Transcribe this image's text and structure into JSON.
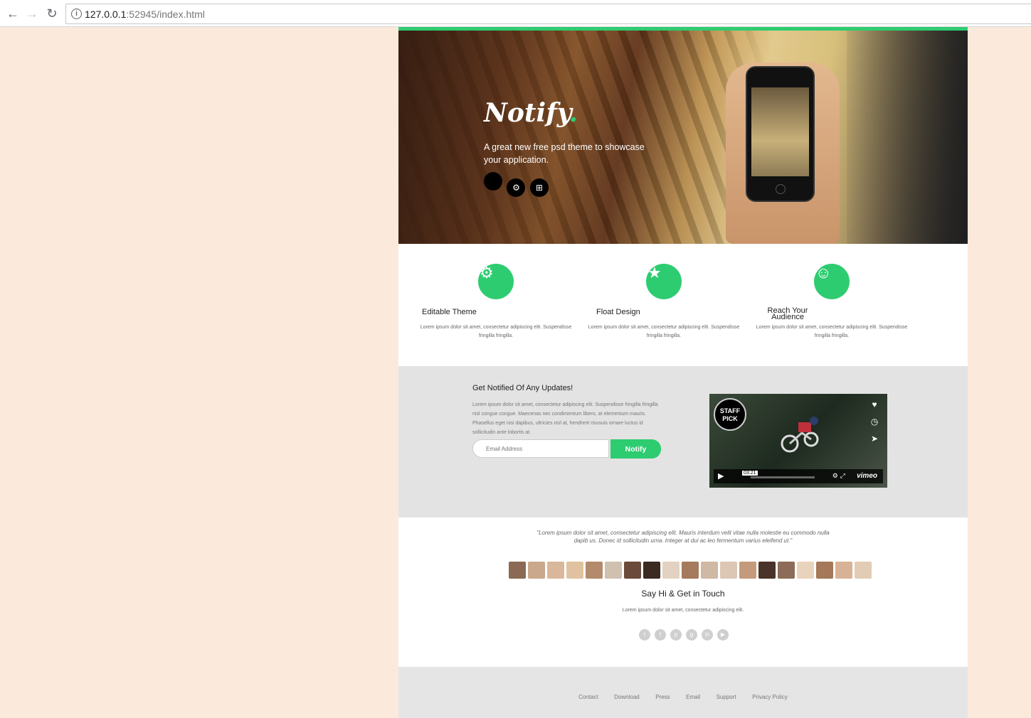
{
  "browser": {
    "url_host": "127.0.0.1",
    "url_rest": ":52945/index.html"
  },
  "hero": {
    "logo": "Notify",
    "logo_dot": ".",
    "tagline": "A great new free psd theme to showcase your application.",
    "store_icons": [
      "apple-icon",
      "android-icon",
      "windows-icon"
    ]
  },
  "features": [
    {
      "title": "Editable Theme",
      "text": "Lorem ipsum dolor sit amet, consectetur adipiscing elit. Suspendisse fringilla fringilla.",
      "icon": "gear-icon"
    },
    {
      "title": "Float Design",
      "text": "Lorem ipsum dolor sit amet, consectetur adipiscing elit. Suspendisse fringilla fringilla.",
      "icon": "star-icon"
    },
    {
      "title": "Reach Your Audience",
      "text": "Lorem ipsum dolor sit amet, consectetur adipiscing elit. Suspendisse fringilla fringilla.",
      "icon": "smile-icon"
    }
  ],
  "notify": {
    "title": "Get Notified Of Any Updates!",
    "text": "Lorem ipsum dolor sit amet, consectetur adipiscing elit. Suspendisse fringilla fringilla nisl congue congue. Maecenas nec condimentum libero, at elementum mauris. Phasellus eget nisi dapibus, ultricies nisl at, hendrerit risusuis ornare luctus id sollicitudin ante lobortis at.",
    "email_placeholder": "Email Address",
    "button": "Notify",
    "video": {
      "staff_pick": "STAFF PICK",
      "time": "03:21",
      "brand": "vimeo"
    }
  },
  "testimonial": {
    "quote": "\"Lorem ipsum dolor sit amet, consectetur adipiscing elit. Mauris interdum velit vitae nulla molestie eu commodo nulla dapib us. Donec id sollicitudin urna. Integer at dui ac leo fermentum varius eleifend ut.\"",
    "touch_title": "Say Hi & Get in Touch",
    "touch_text": "Lorem ipsum dolor sit amet, consectetur adipiscing elit.",
    "socials": [
      "twitter-icon",
      "facebook-icon",
      "pinterest-icon",
      "google-plus-icon",
      "linkedin-icon",
      "youtube-icon"
    ]
  },
  "footer": {
    "links": [
      "Contact",
      "Download",
      "Press",
      "Email",
      "Support",
      "Privacy Policy"
    ]
  },
  "colors": {
    "accent": "#2ecc71",
    "page_bg": "#fbeadb"
  }
}
